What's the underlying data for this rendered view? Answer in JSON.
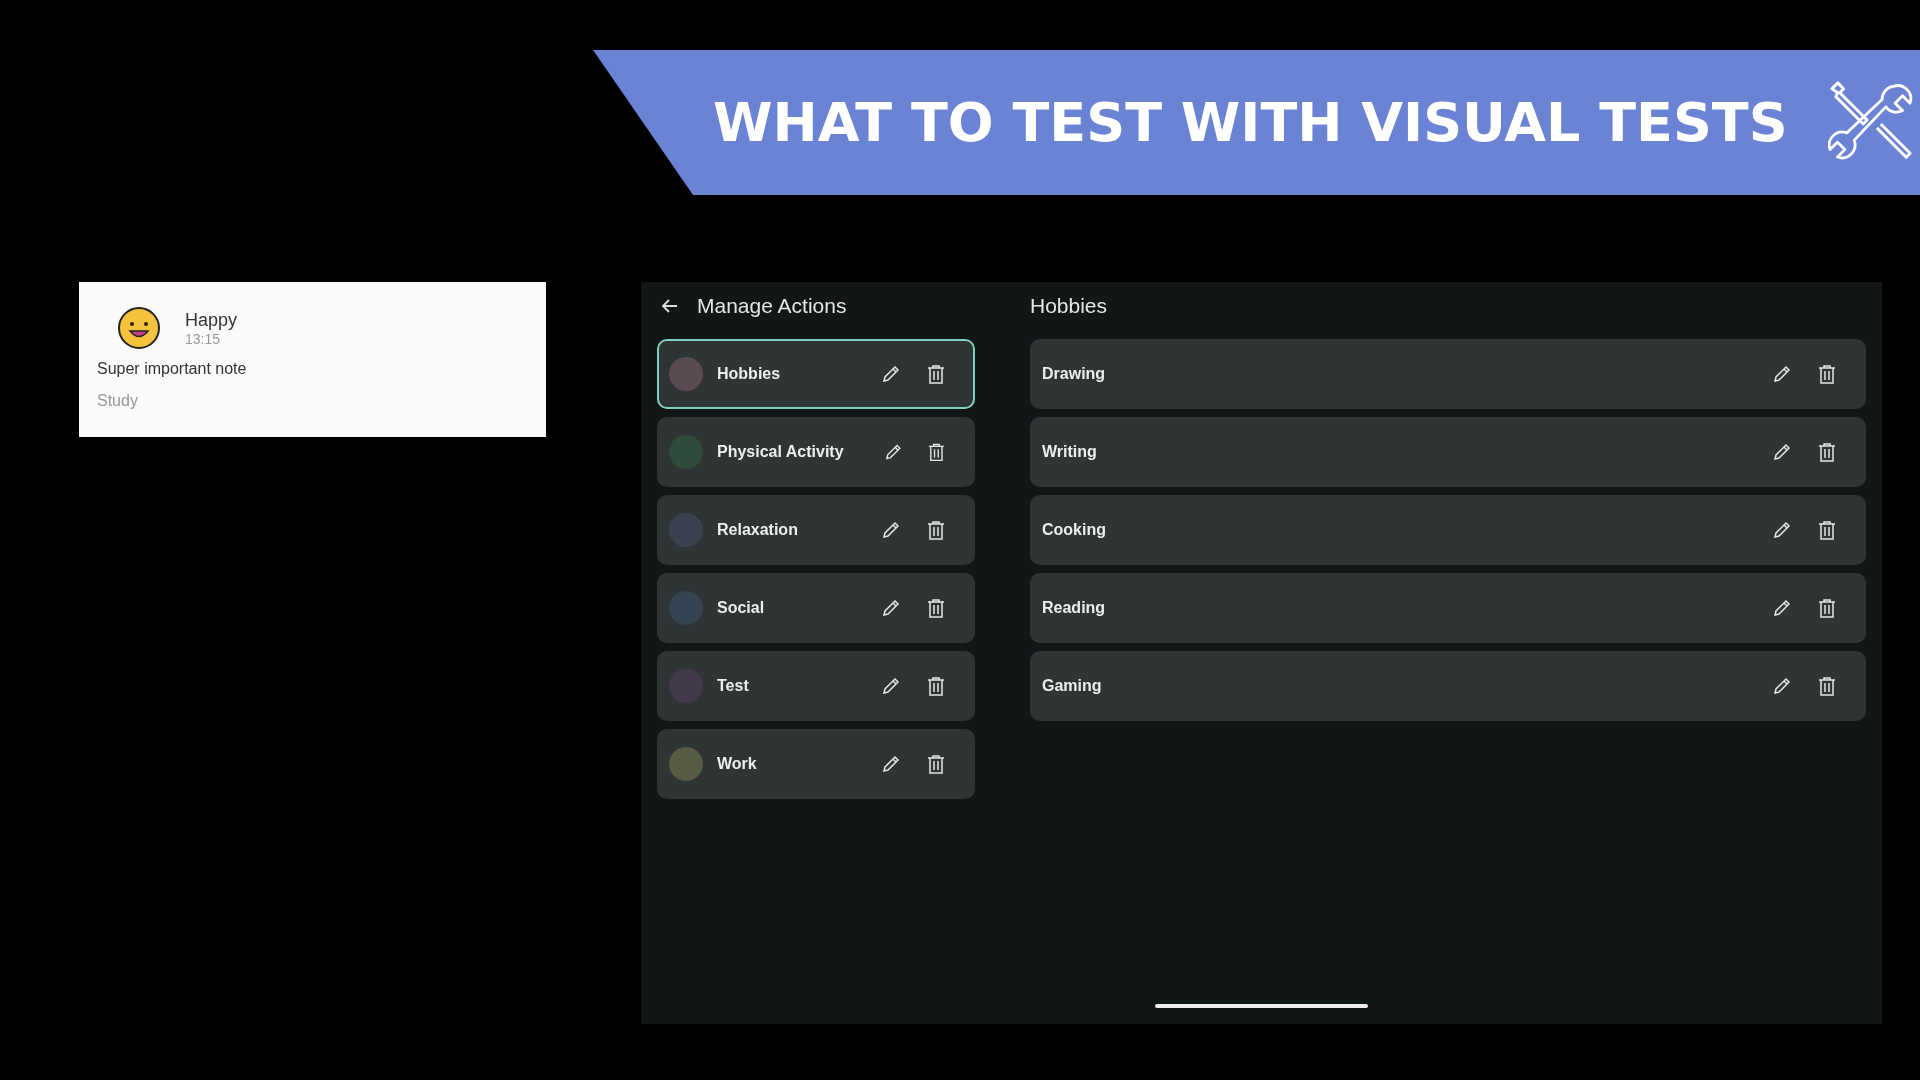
{
  "banner": {
    "title": "WHAT TO TEST WITH VISUAL TESTS"
  },
  "note_card": {
    "mood": "Happy",
    "time": "13:15",
    "text": "Super important note",
    "category": "Study"
  },
  "app": {
    "title": "Manage Actions",
    "categories": [
      {
        "name": "Hobbies",
        "color": "#5a4a52",
        "selected": true
      },
      {
        "name": "Physical Activity",
        "color": "#2e4a3a",
        "selected": false
      },
      {
        "name": "Relaxation",
        "color": "#3c4150",
        "selected": false
      },
      {
        "name": "Social",
        "color": "#354252",
        "selected": false
      },
      {
        "name": "Test",
        "color": "#41394a",
        "selected": false
      },
      {
        "name": "Work",
        "color": "#575a44",
        "selected": false
      }
    ],
    "detail_title": "Hobbies",
    "actions": [
      {
        "name": "Drawing"
      },
      {
        "name": "Writing"
      },
      {
        "name": "Cooking"
      },
      {
        "name": "Reading"
      },
      {
        "name": "Gaming"
      }
    ]
  }
}
